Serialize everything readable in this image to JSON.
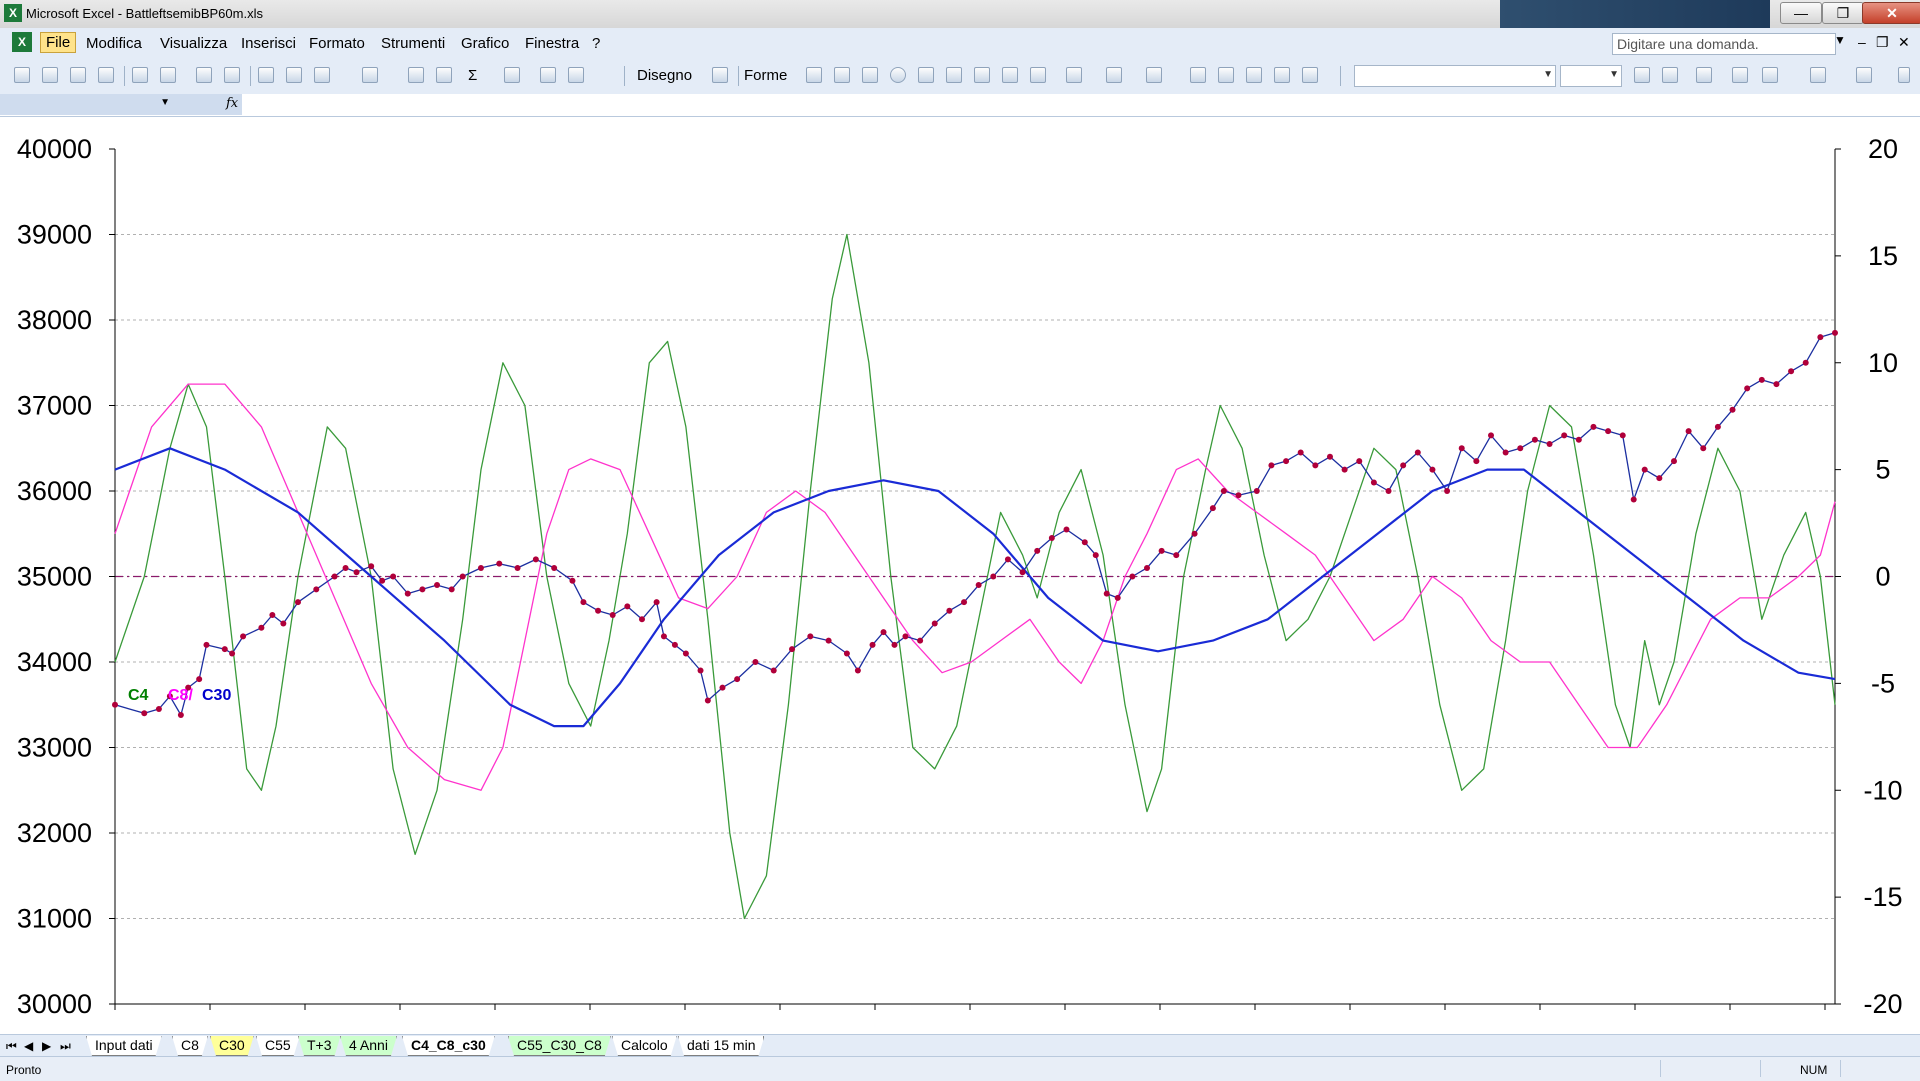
{
  "window": {
    "title": "Microsoft Excel - BattleftsemibBP60m.xls",
    "app_icon": "X"
  },
  "menu": {
    "items": [
      "File",
      "Modifica",
      "Visualizza",
      "Inserisci",
      "Formato",
      "Strumenti",
      "Grafico",
      "Finestra",
      "?"
    ],
    "active": "File",
    "question_placeholder": "Digitare una domanda."
  },
  "toolbar": {
    "drawing_label": "Disegno",
    "shapes_label": "Forme"
  },
  "sheet_tabs": [
    {
      "label": "Input dati",
      "color": "#ffffff"
    },
    {
      "label": "C8",
      "color": "#ffffff"
    },
    {
      "label": "C30",
      "color": "#ffff99"
    },
    {
      "label": "C55",
      "color": "#ffffff"
    },
    {
      "label": "T+3",
      "color": "#ccffcc"
    },
    {
      "label": "4 Anni",
      "color": "#ccffcc"
    },
    {
      "label": "C4_C8_c30",
      "color": "#ffffff",
      "active": true
    },
    {
      "label": "C55_C30_C8",
      "color": "#ccffcc"
    },
    {
      "label": "Calcolo",
      "color": "#ffffff"
    },
    {
      "label": "dati 15 min",
      "color": "#ffffff"
    }
  ],
  "status": {
    "text": "Pronto",
    "num": "NUM"
  },
  "chart_data": {
    "type": "line",
    "left_axis": {
      "min": 30000,
      "max": 40000,
      "ticks": [
        30000,
        31000,
        32000,
        33000,
        34000,
        35000,
        36000,
        37000,
        38000,
        39000,
        40000
      ]
    },
    "right_axis": {
      "min": -20,
      "max": 20,
      "ticks": [
        -20,
        -15,
        -10,
        -5,
        0,
        5,
        10,
        15,
        20
      ]
    },
    "legend": [
      {
        "label": "C4",
        "color": "#008000"
      },
      {
        "label": "C8/",
        "color": "#ff00ff"
      },
      {
        "label": "C30",
        "color": "#0000cc"
      }
    ],
    "grid": true,
    "zero_line": 0,
    "x_count": 470,
    "price_series": {
      "axis": "left",
      "color": "#1c2fa0",
      "marker_color": "#b0003a",
      "points": [
        [
          0,
          33500
        ],
        [
          8,
          33400
        ],
        [
          12,
          33450
        ],
        [
          15,
          33600
        ],
        [
          18,
          33380
        ],
        [
          20,
          33700
        ],
        [
          23,
          33800
        ],
        [
          25,
          34200
        ],
        [
          30,
          34150
        ],
        [
          32,
          34100
        ],
        [
          35,
          34300
        ],
        [
          40,
          34400
        ],
        [
          43,
          34550
        ],
        [
          46,
          34450
        ],
        [
          50,
          34700
        ],
        [
          55,
          34850
        ],
        [
          60,
          35000
        ],
        [
          63,
          35100
        ],
        [
          66,
          35050
        ],
        [
          70,
          35120
        ],
        [
          73,
          34950
        ],
        [
          76,
          35000
        ],
        [
          80,
          34800
        ],
        [
          84,
          34850
        ],
        [
          88,
          34900
        ],
        [
          92,
          34850
        ],
        [
          95,
          35000
        ],
        [
          100,
          35100
        ],
        [
          105,
          35150
        ],
        [
          110,
          35100
        ],
        [
          115,
          35200
        ],
        [
          120,
          35100
        ],
        [
          125,
          34950
        ],
        [
          128,
          34700
        ],
        [
          132,
          34600
        ],
        [
          136,
          34550
        ],
        [
          140,
          34650
        ],
        [
          144,
          34500
        ],
        [
          148,
          34700
        ],
        [
          150,
          34300
        ],
        [
          153,
          34200
        ],
        [
          156,
          34100
        ],
        [
          160,
          33900
        ],
        [
          162,
          33550
        ],
        [
          166,
          33700
        ],
        [
          170,
          33800
        ],
        [
          175,
          34000
        ],
        [
          180,
          33900
        ],
        [
          185,
          34150
        ],
        [
          190,
          34300
        ],
        [
          195,
          34250
        ],
        [
          200,
          34100
        ],
        [
          203,
          33900
        ],
        [
          207,
          34200
        ],
        [
          210,
          34350
        ],
        [
          213,
          34200
        ],
        [
          216,
          34300
        ],
        [
          220,
          34250
        ],
        [
          224,
          34450
        ],
        [
          228,
          34600
        ],
        [
          232,
          34700
        ],
        [
          236,
          34900
        ],
        [
          240,
          35000
        ],
        [
          244,
          35200
        ],
        [
          248,
          35050
        ],
        [
          252,
          35300
        ],
        [
          256,
          35450
        ],
        [
          260,
          35550
        ],
        [
          265,
          35400
        ],
        [
          268,
          35250
        ],
        [
          271,
          34800
        ],
        [
          274,
          34750
        ],
        [
          278,
          35000
        ],
        [
          282,
          35100
        ],
        [
          286,
          35300
        ],
        [
          290,
          35250
        ],
        [
          295,
          35500
        ],
        [
          300,
          35800
        ],
        [
          303,
          36000
        ],
        [
          307,
          35950
        ],
        [
          312,
          36000
        ],
        [
          316,
          36300
        ],
        [
          320,
          36350
        ],
        [
          324,
          36450
        ],
        [
          328,
          36300
        ],
        [
          332,
          36400
        ],
        [
          336,
          36250
        ],
        [
          340,
          36350
        ],
        [
          344,
          36100
        ],
        [
          348,
          36000
        ],
        [
          352,
          36300
        ],
        [
          356,
          36450
        ],
        [
          360,
          36250
        ],
        [
          364,
          36000
        ],
        [
          368,
          36500
        ],
        [
          372,
          36350
        ],
        [
          376,
          36650
        ],
        [
          380,
          36450
        ],
        [
          384,
          36500
        ],
        [
          388,
          36600
        ],
        [
          392,
          36550
        ],
        [
          396,
          36650
        ],
        [
          400,
          36600
        ],
        [
          404,
          36750
        ],
        [
          408,
          36700
        ],
        [
          412,
          36650
        ],
        [
          415,
          35900
        ],
        [
          418,
          36250
        ],
        [
          422,
          36150
        ],
        [
          426,
          36350
        ],
        [
          430,
          36700
        ],
        [
          434,
          36500
        ],
        [
          438,
          36750
        ],
        [
          442,
          36950
        ],
        [
          446,
          37200
        ],
        [
          450,
          37300
        ],
        [
          454,
          37250
        ],
        [
          458,
          37400
        ],
        [
          462,
          37500
        ],
        [
          466,
          37800
        ],
        [
          470,
          37850
        ]
      ]
    },
    "series_C4": {
      "axis": "right",
      "color": "#3a9a3a",
      "points": [
        [
          0,
          -4
        ],
        [
          8,
          0
        ],
        [
          15,
          6
        ],
        [
          20,
          9
        ],
        [
          25,
          7
        ],
        [
          30,
          0
        ],
        [
          36,
          -9
        ],
        [
          40,
          -10
        ],
        [
          44,
          -7
        ],
        [
          50,
          0
        ],
        [
          58,
          7
        ],
        [
          63,
          6
        ],
        [
          70,
          0
        ],
        [
          76,
          -9
        ],
        [
          82,
          -13
        ],
        [
          88,
          -10
        ],
        [
          95,
          -2
        ],
        [
          100,
          5
        ],
        [
          106,
          10
        ],
        [
          112,
          8
        ],
        [
          118,
          0
        ],
        [
          124,
          -5
        ],
        [
          130,
          -7
        ],
        [
          135,
          -3
        ],
        [
          140,
          2
        ],
        [
          146,
          10
        ],
        [
          151,
          11
        ],
        [
          156,
          7
        ],
        [
          162,
          -2
        ],
        [
          168,
          -12
        ],
        [
          172,
          -16
        ],
        [
          178,
          -14
        ],
        [
          184,
          -6
        ],
        [
          190,
          4
        ],
        [
          196,
          13
        ],
        [
          200,
          16
        ],
        [
          206,
          10
        ],
        [
          212,
          0
        ],
        [
          218,
          -8
        ],
        [
          224,
          -9
        ],
        [
          230,
          -7
        ],
        [
          236,
          -2
        ],
        [
          242,
          3
        ],
        [
          248,
          1
        ],
        [
          252,
          -1
        ],
        [
          258,
          3
        ],
        [
          264,
          5
        ],
        [
          270,
          1
        ],
        [
          276,
          -6
        ],
        [
          282,
          -11
        ],
        [
          286,
          -9
        ],
        [
          292,
          0
        ],
        [
          298,
          5
        ],
        [
          302,
          8
        ],
        [
          308,
          6
        ],
        [
          314,
          1
        ],
        [
          320,
          -3
        ],
        [
          326,
          -2
        ],
        [
          332,
          0
        ],
        [
          338,
          3
        ],
        [
          344,
          6
        ],
        [
          350,
          5
        ],
        [
          356,
          0
        ],
        [
          362,
          -6
        ],
        [
          368,
          -10
        ],
        [
          374,
          -9
        ],
        [
          380,
          -3
        ],
        [
          386,
          4
        ],
        [
          392,
          8
        ],
        [
          398,
          7
        ],
        [
          404,
          1
        ],
        [
          410,
          -6
        ],
        [
          414,
          -8
        ],
        [
          418,
          -3
        ],
        [
          422,
          -6
        ],
        [
          426,
          -4
        ],
        [
          432,
          2
        ],
        [
          438,
          6
        ],
        [
          444,
          4
        ],
        [
          450,
          -2
        ],
        [
          456,
          1
        ],
        [
          462,
          3
        ],
        [
          466,
          0
        ],
        [
          470,
          -6
        ]
      ]
    },
    "series_C8": {
      "axis": "right",
      "color": "#ff33cc",
      "points": [
        [
          0,
          2
        ],
        [
          10,
          7
        ],
        [
          20,
          9
        ],
        [
          30,
          9
        ],
        [
          40,
          7
        ],
        [
          50,
          3
        ],
        [
          60,
          -1
        ],
        [
          70,
          -5
        ],
        [
          80,
          -8
        ],
        [
          90,
          -9.5
        ],
        [
          100,
          -10
        ],
        [
          106,
          -8
        ],
        [
          112,
          -3
        ],
        [
          118,
          2
        ],
        [
          124,
          5
        ],
        [
          130,
          5.5
        ],
        [
          138,
          5
        ],
        [
          146,
          2
        ],
        [
          154,
          -1
        ],
        [
          162,
          -1.5
        ],
        [
          170,
          0
        ],
        [
          178,
          3
        ],
        [
          186,
          4
        ],
        [
          194,
          3
        ],
        [
          202,
          1
        ],
        [
          210,
          -1
        ],
        [
          218,
          -3
        ],
        [
          226,
          -4.5
        ],
        [
          234,
          -4
        ],
        [
          242,
          -3
        ],
        [
          250,
          -2
        ],
        [
          258,
          -4
        ],
        [
          264,
          -5
        ],
        [
          270,
          -3
        ],
        [
          276,
          0
        ],
        [
          282,
          2
        ],
        [
          290,
          5
        ],
        [
          296,
          5.5
        ],
        [
          304,
          4
        ],
        [
          312,
          3
        ],
        [
          320,
          2
        ],
        [
          328,
          1
        ],
        [
          336,
          -1
        ],
        [
          344,
          -3
        ],
        [
          352,
          -2
        ],
        [
          360,
          0
        ],
        [
          368,
          -1
        ],
        [
          376,
          -3
        ],
        [
          384,
          -4
        ],
        [
          392,
          -4
        ],
        [
          400,
          -6
        ],
        [
          408,
          -8
        ],
        [
          416,
          -8
        ],
        [
          424,
          -6
        ],
        [
          430,
          -4
        ],
        [
          436,
          -2
        ],
        [
          444,
          -1
        ],
        [
          452,
          -1
        ],
        [
          460,
          0
        ],
        [
          466,
          1
        ],
        [
          470,
          3.5
        ]
      ]
    },
    "series_C30": {
      "axis": "right",
      "color": "#1a2bd6",
      "points": [
        [
          0,
          5
        ],
        [
          15,
          6
        ],
        [
          30,
          5
        ],
        [
          50,
          3
        ],
        [
          70,
          0
        ],
        [
          90,
          -3
        ],
        [
          108,
          -6
        ],
        [
          120,
          -7
        ],
        [
          128,
          -7
        ],
        [
          138,
          -5
        ],
        [
          150,
          -2
        ],
        [
          165,
          1
        ],
        [
          180,
          3
        ],
        [
          195,
          4
        ],
        [
          210,
          4.5
        ],
        [
          225,
          4
        ],
        [
          240,
          2
        ],
        [
          255,
          -1
        ],
        [
          270,
          -3
        ],
        [
          285,
          -3.5
        ],
        [
          300,
          -3
        ],
        [
          315,
          -2
        ],
        [
          330,
          0
        ],
        [
          345,
          2
        ],
        [
          360,
          4
        ],
        [
          375,
          5
        ],
        [
          385,
          5
        ],
        [
          400,
          3
        ],
        [
          415,
          1
        ],
        [
          430,
          -1
        ],
        [
          445,
          -3
        ],
        [
          460,
          -4.5
        ],
        [
          470,
          -4.8
        ]
      ]
    }
  }
}
